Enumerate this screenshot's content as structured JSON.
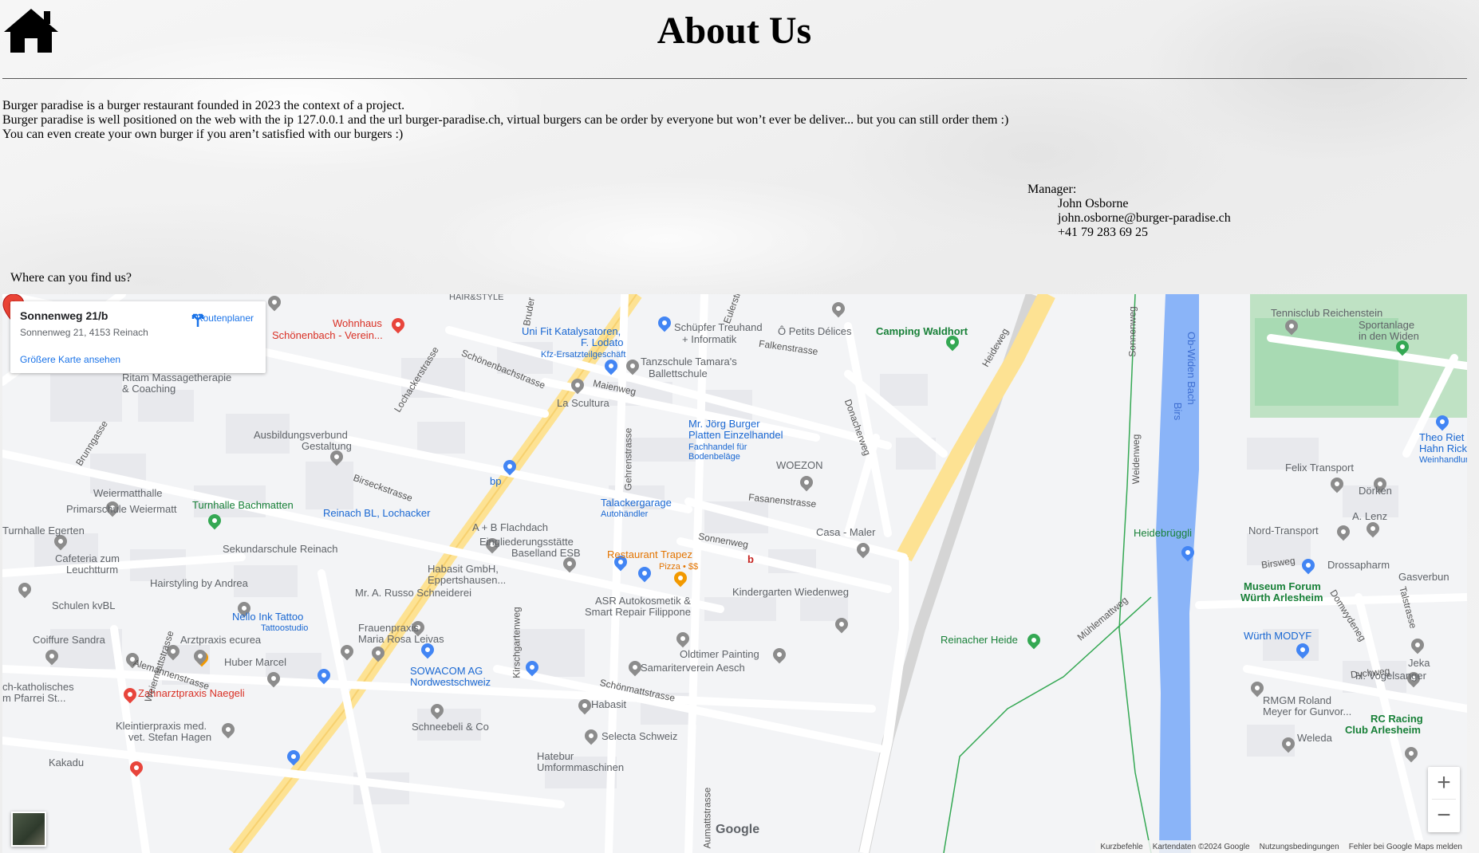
{
  "header": {
    "home_icon": "home-icon",
    "title": "About Us"
  },
  "about": {
    "lines": [
      "Burger paradise is a burger restaurant founded in 2023 the context of a project.",
      "Burger paradise is well positioned on the web with the ip 127.0.0.1 and the url burger-paradise.ch, virtual burgers can be order by everyone but won’t ever be deliver... but you can still order them :)",
      "You can even create your own burger if you aren’t satisfied with our burgers :)"
    ]
  },
  "manager": {
    "label": "Manager:",
    "name": "John Osborne",
    "email": "john.osborne@burger-paradise.ch",
    "phone": "+41 79 283 69 25"
  },
  "find_us": {
    "label": "Where can you find us?"
  },
  "map": {
    "place_name": "Sonnenweg 21/b",
    "place_address": "Sonnenweg 21, 4153 Reinach",
    "directions_label": "Routenplaner",
    "larger_map_label": "Größere Karte ansehen",
    "marker_label": "b",
    "google_logo": "Google",
    "zoom_in": "+",
    "zoom_out": "−",
    "attribution": {
      "shortcuts": "Kurzbefehle",
      "map_data": "Kartendaten ©2024 Google",
      "terms": "Nutzungsbedingungen",
      "report": "Fehler bei Google Maps melden"
    },
    "labels": [
      "HAIR&STYLE",
      "Wohnhaus",
      "Schönenbach - Verein...",
      "Uni Fit Katalysatoren,",
      "F. Lodato",
      "Kfz-Ersatzteilgeschäft",
      "Schüpfer Treuhand",
      "+ Informatik",
      "Ô Petits Délices",
      "Camping Waldhort",
      "Tennisclub Reichenstein",
      "Sportanlage",
      "in den Widen",
      "Schönenbachstrasse",
      "Falkenstrasse",
      "Tanzschule Tamara's",
      "Ballettschule",
      "Ritam Massagetherapie",
      "& Coaching",
      "Maienweg",
      "La Scultura",
      "Lochackerstrasse",
      "Brunngasse",
      "Ausbildungsverbund",
      "Gestaltung",
      "Mr. Jörg Burger",
      "Platten Einzelhandel",
      "Fachhandel für",
      "Bodenbeläge",
      "WOEZON",
      "Birs",
      "Ob-Widen Bach",
      "Weiermatthalle",
      "Turnhalle Bachmatten",
      "Primarschule Weiermatt",
      "Birseckstrasse",
      "bp",
      "Fasanenstrasse",
      "Reinach BL, Lochacker",
      "Talackergarage",
      "Autohändler",
      "A + B Flachdach",
      "Casa - Maler",
      "Turnhalle Egerten",
      "Eingliederungsstätte",
      "Baselland ESB",
      "Sonnenweg",
      "Restaurant Trapez",
      "Pizza • $$",
      "Heidebrüggli",
      "Nord-Transport",
      "Felix Transport",
      "Dörken",
      "A. Lenz",
      "Theo Riet",
      "Hahn Rick",
      "Weinhandlun",
      "Cafeteria zum",
      "Leuchtturm",
      "Sekundarschule Reinach",
      "Habasit GmbH,",
      "Eppertshausen...",
      "Kindergarten Wiedenweg",
      "Drossapharm",
      "Gasverbun",
      "Museum Forum",
      "Würth Arlesheim",
      "Hairstyling by Andrea",
      "Mr. A. Russo Schneiderei",
      "ASR Autokosmetik &",
      "Smart Repair Filippone",
      "Schulen kvBL",
      "Nello Ink Tattoo",
      "Tattoostudio",
      "Frauenpraxis",
      "Maria Rosa Leivas",
      "Reinacher Heide",
      "Würth MODYF",
      "Coiffure Sandra",
      "Arztpraxis ecurea",
      "Oldtimer Painting",
      "Samariterverein Aesch",
      "Jeka",
      "H. Vogelsanger",
      "Huber Marcel",
      "SOWACOM AG",
      "Nordwestschweiz",
      "Alemannenstrasse",
      "ch-katholisches",
      "m Pfarrei St...",
      "Zahnarztpraxis Naegeli",
      "Schönmattstrasse",
      "Habasit",
      "RMGM Roland",
      "Meyer for Gunvor...",
      "RC Racing",
      "Club Arlesheim",
      "Kleintierpraxis med.",
      "vet. Stefan Hagen",
      "Schneebeli & Co",
      "Selecta Schweiz",
      "Weleda",
      "Kakadu",
      "Hatebur",
      "Umformmaschinen",
      "Talstrasse",
      "Birsweg",
      "Dychweg",
      "Domwydeneg",
      "Mühlemattweg",
      "Weidenweg",
      "Sonnenweg",
      "Heideweg",
      "Donacherweg",
      "Gehrenstrasse",
      "Kirschgartenweg",
      "Aumattstrasse",
      "Weiermattstrasse",
      "Bruder",
      "Eulerstr"
    ]
  }
}
